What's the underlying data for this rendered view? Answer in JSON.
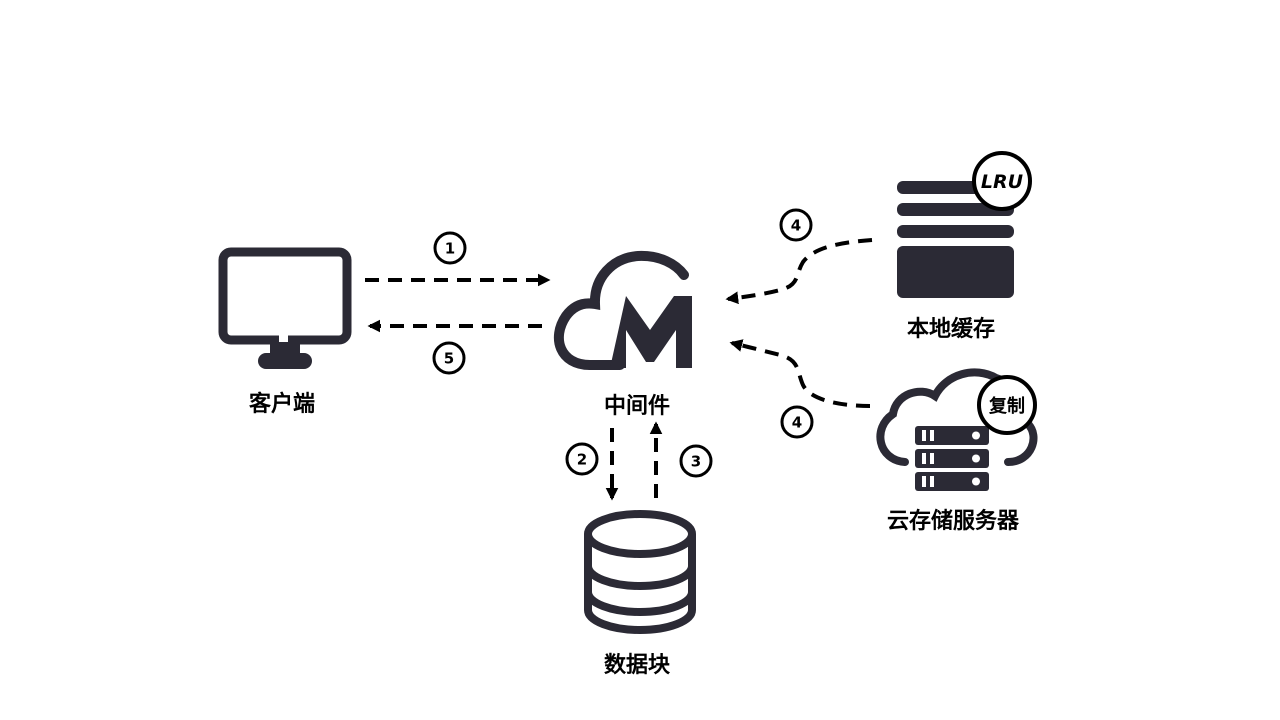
{
  "colors": {
    "icon": "#2b2a35",
    "arrow": "#000000",
    "text": "#000000",
    "background": "#ffffff"
  },
  "nodes": {
    "client": {
      "label": "客户端",
      "icon": "monitor-icon"
    },
    "middleware": {
      "label": "中间件",
      "icon": "cloud-m-logo-icon"
    },
    "data_block": {
      "label": "数据块",
      "icon": "database-icon"
    },
    "local_cache": {
      "label": "本地缓存",
      "icon": "server-stack-icon",
      "badge": "LRU"
    },
    "cloud_storage": {
      "label": "云存储服务器",
      "icon": "cloud-server-icon",
      "badge": "复制"
    }
  },
  "steps": {
    "s1": "1",
    "s2": "2",
    "s3": "3",
    "s4_cache": "4",
    "s4_cloud": "4",
    "s5": "5"
  }
}
